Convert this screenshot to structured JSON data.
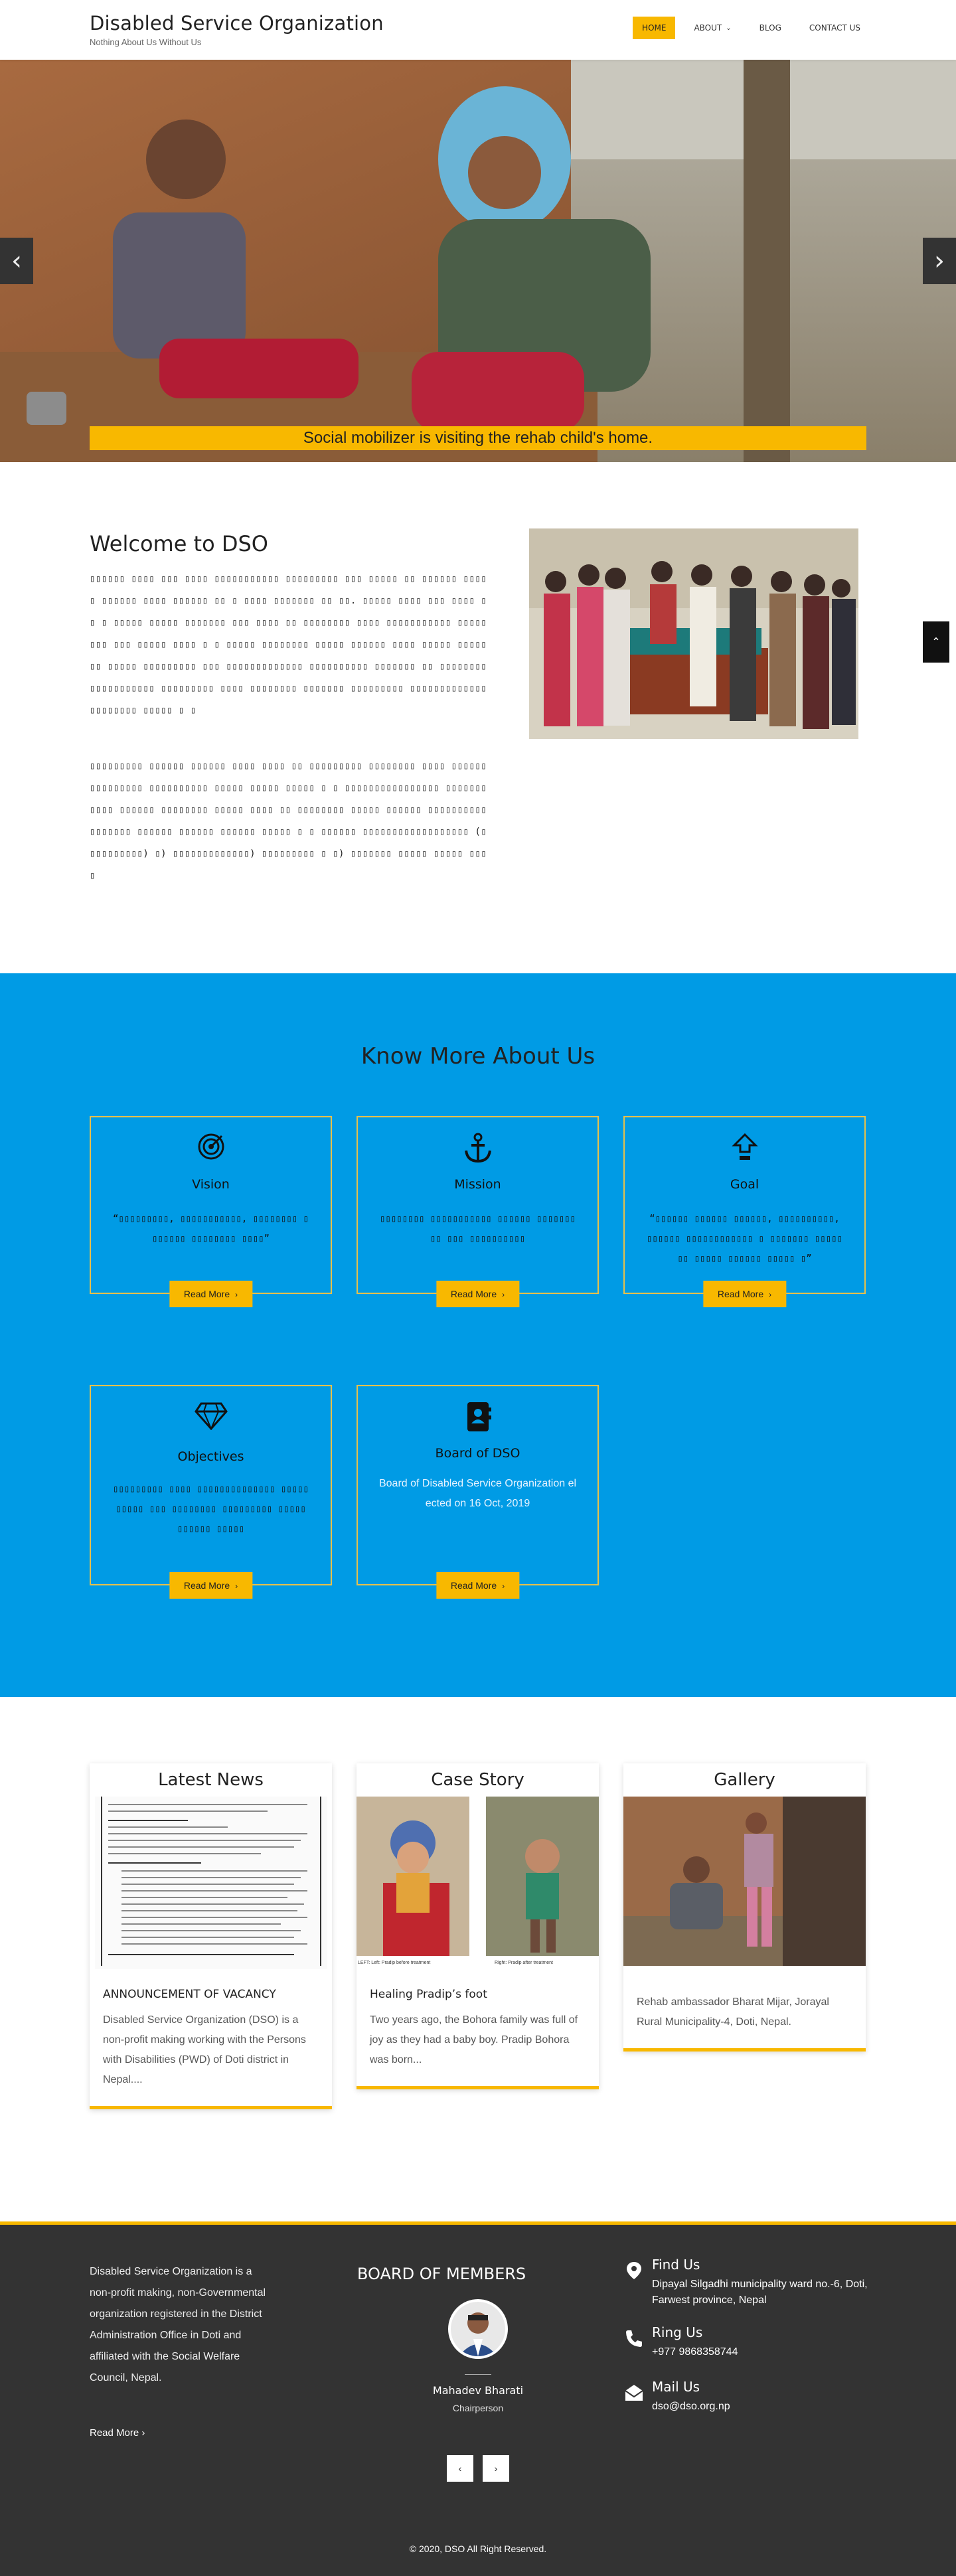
{
  "header": {
    "title": "Disabled Service Organization",
    "tagline": "Nothing About Us Without Us",
    "nav": [
      {
        "label": "HOME",
        "active": true
      },
      {
        "label": "ABOUT",
        "has_dropdown": true
      },
      {
        "label": "BLOG"
      },
      {
        "label": "CONTACT US"
      }
    ]
  },
  "hero": {
    "caption": "Social mobilizer is visiting the rehab child's home.",
    "prev_glyph": "‹",
    "next_glyph": "›"
  },
  "welcome": {
    "heading": "Welcome to DSO",
    "para1": "▯▯▯▯▯▯ ▯▯▯▯ ▯▯▯ ▯▯▯▯ ▯▯▯▯▯▯▯▯▯▯▯ ▯▯▯▯▯▯▯▯▯ ▯▯▯ ▯▯▯▯▯ ▯▯ ▯▯▯▯▯▯ ▯▯▯▯▯ ▯▯▯▯▯▯ ▯▯▯▯ ▯▯▯▯▯▯ ▯▯ ▯ ▯▯▯▯ ▯▯▯▯▯▯▯ ▯▯ ▯▯. ▯▯▯▯▯ ▯▯▯▯ ▯▯▯ ▯▯▯▯ ▯▯ ▯ ▯▯▯▯▯ ▯▯▯▯▯ ▯▯▯▯▯▯▯ ▯▯▯ ▯▯▯▯ ▯▯ ▯▯▯▯▯▯▯▯ ▯▯▯▯ ▯▯▯▯▯▯▯▯▯▯▯ ▯▯▯▯▯▯▯▯ ▯▯▯ ▯▯▯▯▯ ▯▯▯▯ ▯ ▯ ▯▯▯▯▯ ▯▯▯▯▯▯▯▯ ▯▯▯▯▯ ▯▯▯▯▯▯ ▯▯▯▯ ▯▯▯▯▯ ▯▯▯▯▯▯▯ ▯▯▯▯▯ ▯▯▯▯▯▯▯▯▯ ▯▯▯ ▯▯▯▯▯▯▯▯▯▯▯▯▯ ▯▯▯▯▯▯▯▯▯▯ ▯▯▯▯▯▯▯ ▯▯ ▯▯▯▯▯▯▯▯▯▯▯▯▯▯▯▯▯▯▯ ▯▯▯▯▯▯▯▯▯ ▯▯▯▯ ▯▯▯▯▯▯▯▯ ▯▯▯▯▯▯▯ ▯▯▯▯▯▯▯▯▯ ▯▯▯▯▯▯▯▯▯▯▯▯▯ ▯▯▯▯▯▯▯▯ ▯▯▯▯▯ ▯ ▯",
    "para2": "▯▯▯▯▯▯▯▯▯ ▯▯▯▯▯▯ ▯▯▯▯▯▯ ▯▯▯▯ ▯▯▯▯ ▯▯ ▯▯▯▯▯▯▯▯▯ ▯▯▯▯▯▯▯▯ ▯▯▯▯ ▯▯▯▯▯▯▯▯▯▯▯▯▯▯▯ ▯▯▯▯▯▯▯▯▯▯ ▯▯▯▯▯ ▯▯▯▯▯ ▯▯▯▯▯ ▯ ▯ ▯▯▯▯▯▯▯▯▯▯▯▯▯▯▯▯ ▯▯▯▯▯▯▯▯▯▯▯ ▯▯▯▯▯▯ ▯▯▯▯▯▯▯▯ ▯▯▯▯▯ ▯▯▯▯ ▯▯ ▯▯▯▯▯▯▯▯ ▯▯▯▯▯ ▯▯▯▯▯▯ ▯▯▯▯▯▯▯▯▯▯▯▯▯▯▯▯▯ ▯▯▯▯▯▯ ▯▯▯▯▯▯ ▯▯▯▯▯▯ ▯▯▯▯▯ ▯ ▯ ▯▯▯▯▯▯ ▯▯▯▯▯▯▯▯▯▯▯▯▯▯▯▯▯▯ (▯ ▯▯▯▯▯▯▯▯▯) ▯) ▯▯▯▯▯▯▯▯▯▯▯▯▯) ▯▯▯▯▯▯▯▯▯ ▯ ▯) ▯▯▯▯▯▯▯ ▯▯▯▯▯ ▯▯▯▯▯ ▯▯▯ ▯"
  },
  "know_more": {
    "heading": "Know More About Us",
    "cards": [
      {
        "title": "Vision",
        "icon": "target-icon",
        "text": "“▯▯▯▯▯▯▯▯▯, ▯▯▯▯▯▯▯▯▯▯▯, ▯▯▯▯▯▯▯▯ ▯ ▯▯▯▯▯▯ ▯▯▯▯▯▯▯▯ ▯▯▯▯”",
        "button": "Read More"
      },
      {
        "title": "Mission",
        "icon": "anchor-icon",
        "text": "▯▯▯▯▯▯▯▯ ▯▯▯▯▯▯▯▯▯▯▯ ▯▯▯▯▯▯ ▯▯▯▯▯▯▯▯▯ ▯▯▯ ▯▯▯▯▯▯▯▯▯▯",
        "button": "Read More"
      },
      {
        "title": "Goal",
        "icon": "arrow-up-box-icon",
        "text": "“▯▯▯▯▯▯ ▯▯▯▯▯▯ ▯▯▯▯▯▯, ▯▯▯▯▯▯▯▯▯▯, ▯▯▯▯▯▯ ▯▯▯▯▯▯▯▯▯▯▯▯ ▯ ▯▯▯▯▯▯▯ ▯▯▯▯▯▯▯ ▯▯▯▯▯ ▯▯▯▯▯▯ ▯▯▯▯▯ ▯”",
        "button": "Read More"
      },
      {
        "title": "Objectives",
        "icon": "diamond-icon",
        "text": "▯▯▯▯▯▯▯▯▯ ▯▯▯▯ ▯▯▯▯▯▯▯▯▯▯▯▯▯▯ ▯▯▯▯▯▯▯▯▯▯ ▯▯▯ ▯▯▯▯▯▯▯▯ ▯▯▯▯▯▯▯▯▯ ▯▯▯▯▯ ▯▯▯▯▯▯ ▯▯▯▯▯",
        "button": "Read More"
      },
      {
        "title": "Board of DSO",
        "icon": "contact-book-icon",
        "text": "Board of Disabled Service Organization elected on 16 Oct, 2019",
        "button": "Read More"
      }
    ]
  },
  "news": {
    "cards": [
      {
        "heading": "Latest News",
        "title": "ANNOUNCEMENT OF VACANCY",
        "text": "Disabled Service Organization (DSO) is a non-profit making working with the Persons with Disabilities (PWD) of Doti district in Nepal...."
      },
      {
        "heading": "Case Story",
        "title": "Healing Pradip’s foot",
        "text": "Two years ago, the Bohora family was full of joy as they had a baby boy. Pradip Bohora was born...",
        "img_caption_left": "LEFT: Left: Pradip before treatment",
        "img_caption_right": "Right: Pradip after treatment"
      },
      {
        "heading": "Gallery",
        "title": "",
        "text": "Rehab ambassador Bharat Mijar, Jorayal Rural Municipality-4, Doti, Nepal."
      }
    ]
  },
  "footer": {
    "about": "Disabled Service Organization is a non-profit making, non-Governmental organization registered in the District Administration Office in Doti and affiliated with the Social Welfare Council, Nepal.",
    "read_more": "Read More",
    "board_title": "BOARD OF MEMBERS",
    "member_name": "Mahadev Bharati",
    "member_role": "Chairperson",
    "pager_prev": "‹",
    "pager_next": "›",
    "contacts": [
      {
        "label": "Find Us",
        "icon": "location-pin-icon",
        "value": "Dipayal Silgadhi municipality ward no.-6, Doti, Farwest province, Nepal"
      },
      {
        "label": "Ring Us",
        "icon": "phone-icon",
        "value": "+977 9868358744"
      },
      {
        "label": "Mail Us",
        "icon": "envelope-icon",
        "value": "dso@dso.org.np"
      }
    ],
    "copyright": "© 2020, DSO All Right Reserved."
  },
  "colors": {
    "accent": "#f8b800",
    "blue_section": "#009be5",
    "footer_bg": "#333333"
  }
}
